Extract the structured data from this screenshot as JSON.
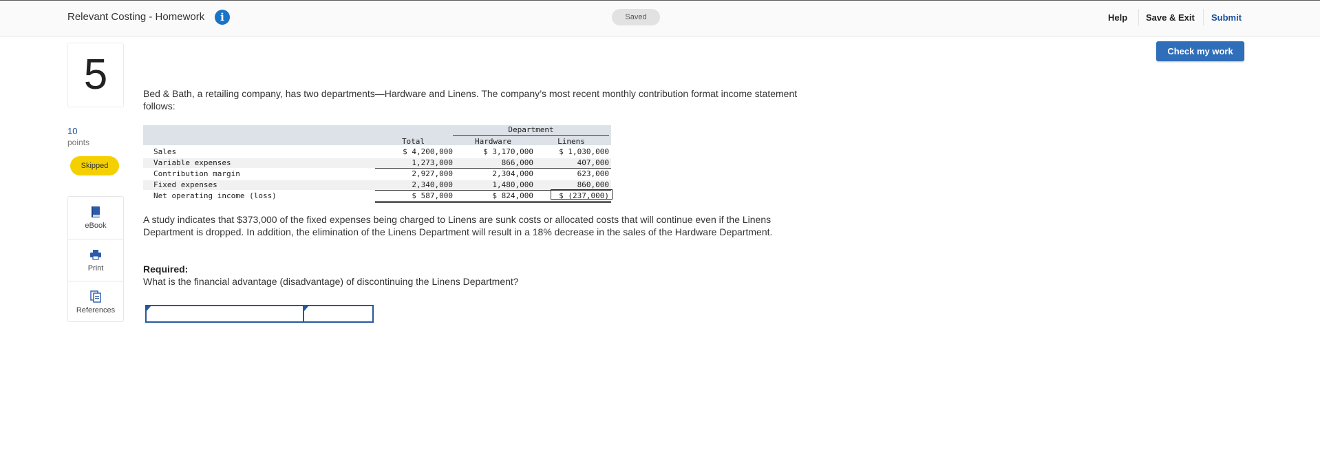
{
  "header": {
    "assignment_title": "Relevant Costing - Homework",
    "info_icon": "info-icon",
    "save_status": "Saved",
    "help_label": "Help",
    "save_exit_label": "Save & Exit",
    "submit_label": "Submit"
  },
  "check_work_label": "Check my work",
  "question": {
    "number": "5",
    "points_value": "10",
    "points_label": "points",
    "status": "Skipped"
  },
  "tools": [
    {
      "label": "eBook",
      "icon": "book-icon"
    },
    {
      "label": "Print",
      "icon": "printer-icon"
    },
    {
      "label": "References",
      "icon": "references-icon"
    }
  ],
  "content": {
    "intro": "Bed & Bath, a retailing company, has two departments—Hardware and Linens. The company’s most recent monthly contribution format income statement follows:",
    "study": "A study indicates that $373,000 of the fixed expenses being charged to Linens are sunk costs or allocated costs that will continue even if the Linens Department is dropped. In addition, the elimination of the Linens Department will result in a 18% decrease in the sales of the Hardware Department.",
    "required_label": "Required:",
    "required_question": "What is the financial advantage (disadvantage) of discontinuing the Linens Department?"
  },
  "statement": {
    "department_header": "Department",
    "columns": {
      "total": "Total",
      "hardware": "Hardware",
      "linens": "Linens"
    },
    "rows": [
      {
        "label": "Sales",
        "total": "$ 4,200,000",
        "hardware": "$ 3,170,000",
        "linens": "$ 1,030,000"
      },
      {
        "label": "Variable expenses",
        "total": "1,273,000",
        "hardware": "866,000",
        "linens": "407,000"
      },
      {
        "label": "Contribution margin",
        "total": "2,927,000",
        "hardware": "2,304,000",
        "linens": "623,000"
      },
      {
        "label": "Fixed expenses",
        "total": "2,340,000",
        "hardware": "1,480,000",
        "linens": "860,000"
      },
      {
        "label": "Net operating income (loss)",
        "total": "$ 587,000",
        "hardware": "$ 824,000",
        "linens": "$ (237,000)"
      }
    ]
  },
  "answer_fields": {
    "label_value": "",
    "amount_value": ""
  }
}
